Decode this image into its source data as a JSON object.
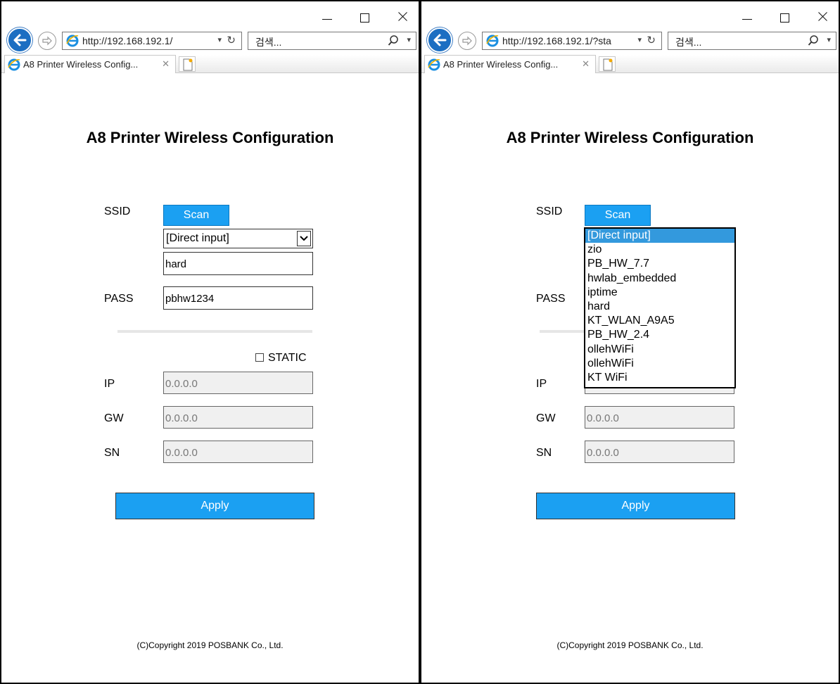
{
  "windows": [
    {
      "address": "http://192.168.192.1/",
      "search_placeholder": "검색...",
      "tab_title": "A8 Printer Wireless Config...",
      "page": {
        "title": "A8 Printer Wireless Configuration",
        "ssid_label": "SSID",
        "scan_label": "Scan",
        "ssid_select_value": "[Direct input]",
        "ssid_input_value": "hard",
        "pass_label": "PASS",
        "pass_value": "pbhw1234",
        "static_label": "STATIC",
        "ip_label": "IP",
        "ip_value": "0.0.0.0",
        "gw_label": "GW",
        "gw_value": "0.0.0.0",
        "sn_label": "SN",
        "sn_value": "0.0.0.0",
        "apply_label": "Apply",
        "copyright": "(C)Copyright 2019 POSBANK Co., Ltd."
      }
    },
    {
      "address": "http://192.168.192.1/?sta",
      "search_placeholder": "검색...",
      "tab_title": "A8 Printer Wireless Config...",
      "page": {
        "title": "A8 Printer Wireless Configuration",
        "ssid_label": "SSID",
        "scan_label": "Scan",
        "pass_label": "PASS",
        "ip_label": "IP",
        "gw_label": "GW",
        "gw_value": "0.0.0.0",
        "sn_label": "SN",
        "sn_value": "0.0.0.0",
        "apply_label": "Apply",
        "copyright": "(C)Copyright 2019 POSBANK Co., Ltd."
      },
      "ssid_options": [
        "[Direct input]",
        "zio",
        "PB_HW_7.7",
        "hwlab_embedded",
        "iptime",
        "hard",
        "KT_WLAN_A9A5",
        "PB_HW_2.4",
        "ollehWiFi",
        "ollehWiFi",
        "KT WiFi"
      ],
      "ssid_selected_option": "[Direct input]"
    }
  ],
  "icons": {
    "back": "back-arrow-icon",
    "forward": "forward-arrow-icon",
    "browser": "ie-browser-icon",
    "refresh": "refresh-icon",
    "search": "magnifier-icon",
    "dropdown": "chevron-down-icon",
    "tab_close": "close-icon",
    "new_tab": "new-tab-icon",
    "window_min": "minimize-icon",
    "window_max": "maximize-icon",
    "window_close": "close-icon"
  },
  "colors": {
    "accent_blue": "#1ba0f2",
    "selected_option": "#3399dd",
    "disabled_field": "#f0f0f0"
  }
}
